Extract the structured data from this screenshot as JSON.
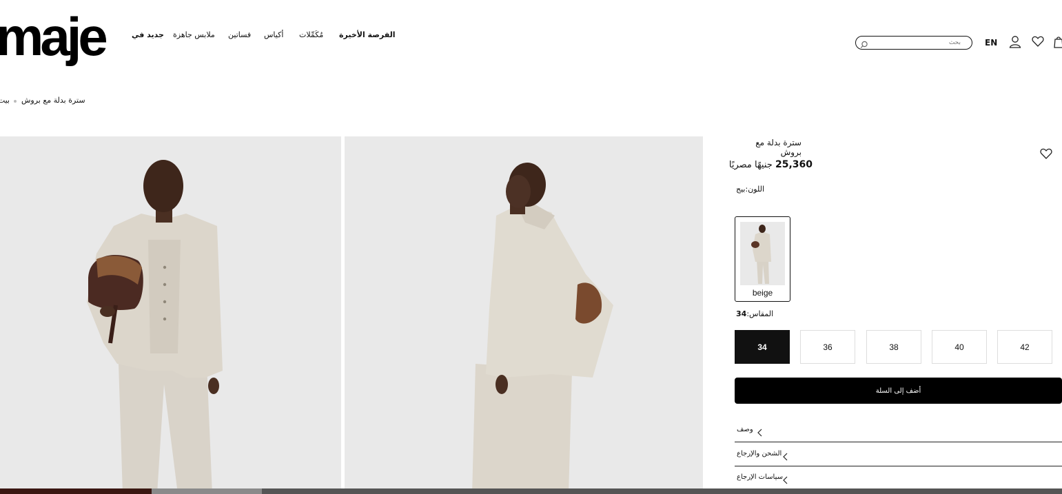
{
  "brand": {
    "logo_text": "maje"
  },
  "nav": {
    "items": [
      {
        "label": "جديد في",
        "bold": true
      },
      {
        "label": "ملابس جاهزة",
        "bold": false
      },
      {
        "label": "فساتين",
        "bold": false
      },
      {
        "label": "أكياس",
        "bold": false
      },
      {
        "label": "مُكَمِّلات",
        "bold": false
      },
      {
        "label": "الفرصة الأخيرة",
        "bold": true
      }
    ]
  },
  "header": {
    "search_placeholder": "بحث",
    "language": "EN",
    "icons": [
      "search-icon",
      "account-icon",
      "wishlist-icon",
      "bag-icon"
    ]
  },
  "breadcrumb": {
    "home": "بيت",
    "current": "سترة بدلة مع بروش"
  },
  "product": {
    "title": "سترة بدلة مع بروش",
    "price_value": "25,360",
    "price_currency": "جنيهًا مصريًا",
    "color_label": "اللون:",
    "color_value": "بيج",
    "swatch_name": "beige",
    "size_label": "المقاس:",
    "size_value": "34",
    "sizes": [
      "34",
      "36",
      "38",
      "40",
      "42"
    ],
    "selected_size": "34",
    "add_to_cart": "أضف إلى السلة",
    "accordions": [
      "وصف",
      "الشحن والإرجاع",
      "سياسات الإرجاع"
    ]
  },
  "gallery": {
    "image_count_shown": 2
  },
  "colors": {
    "text": "#111111",
    "button": "#000000",
    "image_bg": "#e9e9e9"
  }
}
